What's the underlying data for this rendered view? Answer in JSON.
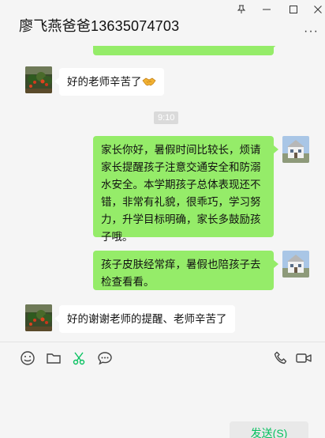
{
  "window": {
    "title": "廖飞燕爸爸13635074703",
    "pin_icon": "pin-icon",
    "minimize_icon": "minimize-icon",
    "maximize_icon": "maximize-icon",
    "close_icon": "close-icon",
    "more_label": "···"
  },
  "messages": [
    {
      "sender": "teacher",
      "text": "好的老师辛苦了",
      "emoji": "handshake"
    },
    {
      "type": "timestamp",
      "text": "9:10"
    },
    {
      "sender": "me",
      "text": "家长你好，暑假时间比较长，烦请家长提醒孩子注意交通安全和防溺水安全。本学期孩子总体表现还不错，非常有礼貌，很乖巧，学习努力，升学目标明确，家长多鼓励孩子哦。"
    },
    {
      "sender": "me",
      "text": "孩子皮肤经常痒，暑假也陪孩子去检查看看。"
    },
    {
      "sender": "teacher",
      "text": "好的谢谢老师的提醒、老师辛苦了"
    }
  ],
  "toolbar": {
    "left_icons": [
      "emoji-icon",
      "folder-icon",
      "scissors-icon",
      "chat-bubble-icon"
    ],
    "right_icons": [
      "phone-icon",
      "video-icon"
    ],
    "accent_color": "#07c160"
  },
  "input": {
    "value": ""
  },
  "send": {
    "label": "发送(S)"
  },
  "colors": {
    "my_bubble": "#95ec69",
    "their_bubble": "#ffffff",
    "background": "#f5f5f5"
  }
}
